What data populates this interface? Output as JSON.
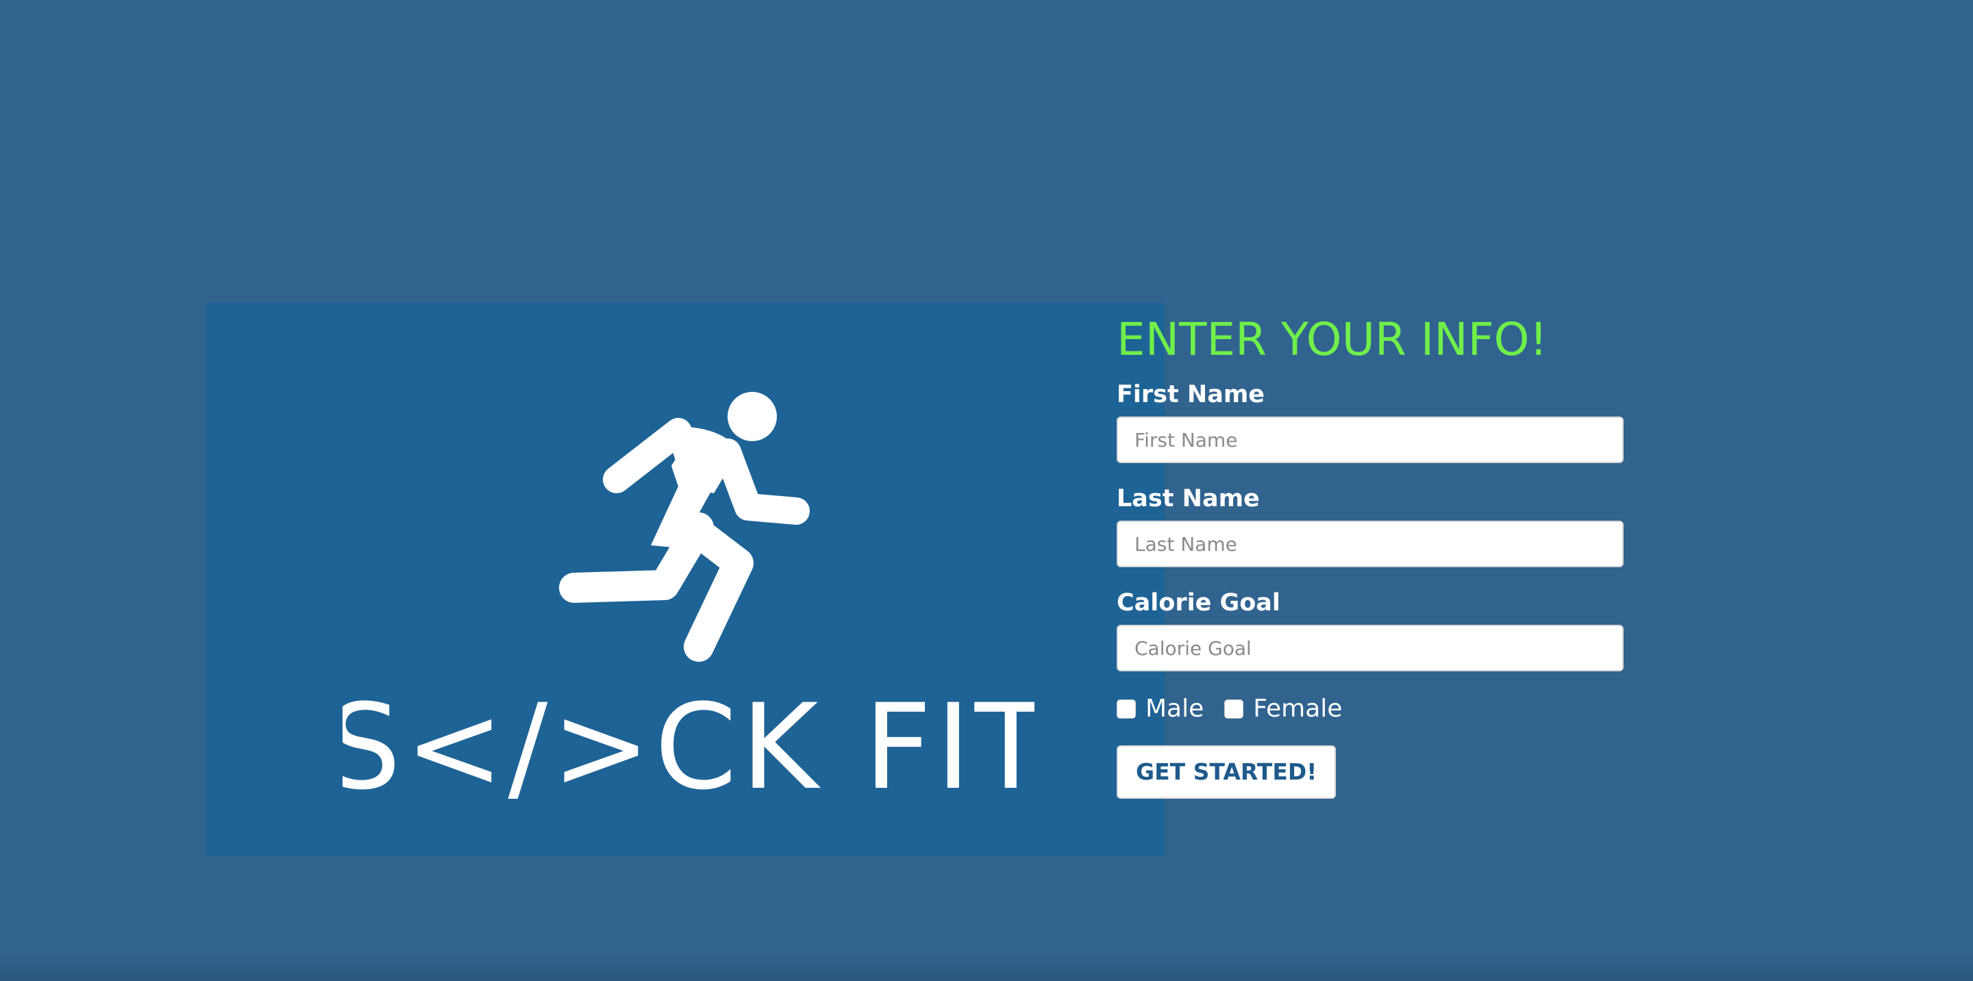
{
  "colors": {
    "background": "#31638f",
    "logo_panel": "#1e6396",
    "title_accent": "#6fef4a",
    "text": "#ffffff",
    "button_text": "#1e5a8c"
  },
  "logo": {
    "icon": "running-person-icon",
    "wordmark": "S</>CK FIT"
  },
  "form": {
    "title": "ENTER YOUR INFO!",
    "first_name": {
      "label": "First Name",
      "placeholder": "First Name",
      "value": ""
    },
    "last_name": {
      "label": "Last Name",
      "placeholder": "Last Name",
      "value": ""
    },
    "calorie_goal": {
      "label": "Calorie Goal",
      "placeholder": "Calorie Goal",
      "value": ""
    },
    "gender_options": [
      {
        "label": "Male",
        "checked": false
      },
      {
        "label": "Female",
        "checked": false
      }
    ],
    "submit_label": "GET STARTED!"
  }
}
